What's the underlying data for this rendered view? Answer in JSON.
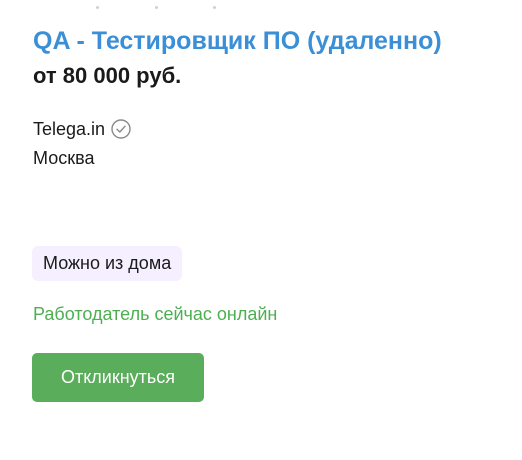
{
  "vacancy": {
    "title": "QA - Тестировщик ПО (удаленно)",
    "salary": "от 80 000 руб.",
    "company": "Telega.in",
    "company_verified_icon": "check-circle-icon",
    "city": "Москва",
    "remote_badge": "Можно из дома",
    "online_status": "Работодатель сейчас онлайн",
    "respond_label": "Откликнуться"
  },
  "colors": {
    "title": "#3a8fd6",
    "online_status": "#4caf50",
    "button": "#5aad5a",
    "badge_background": "#f5efff"
  }
}
